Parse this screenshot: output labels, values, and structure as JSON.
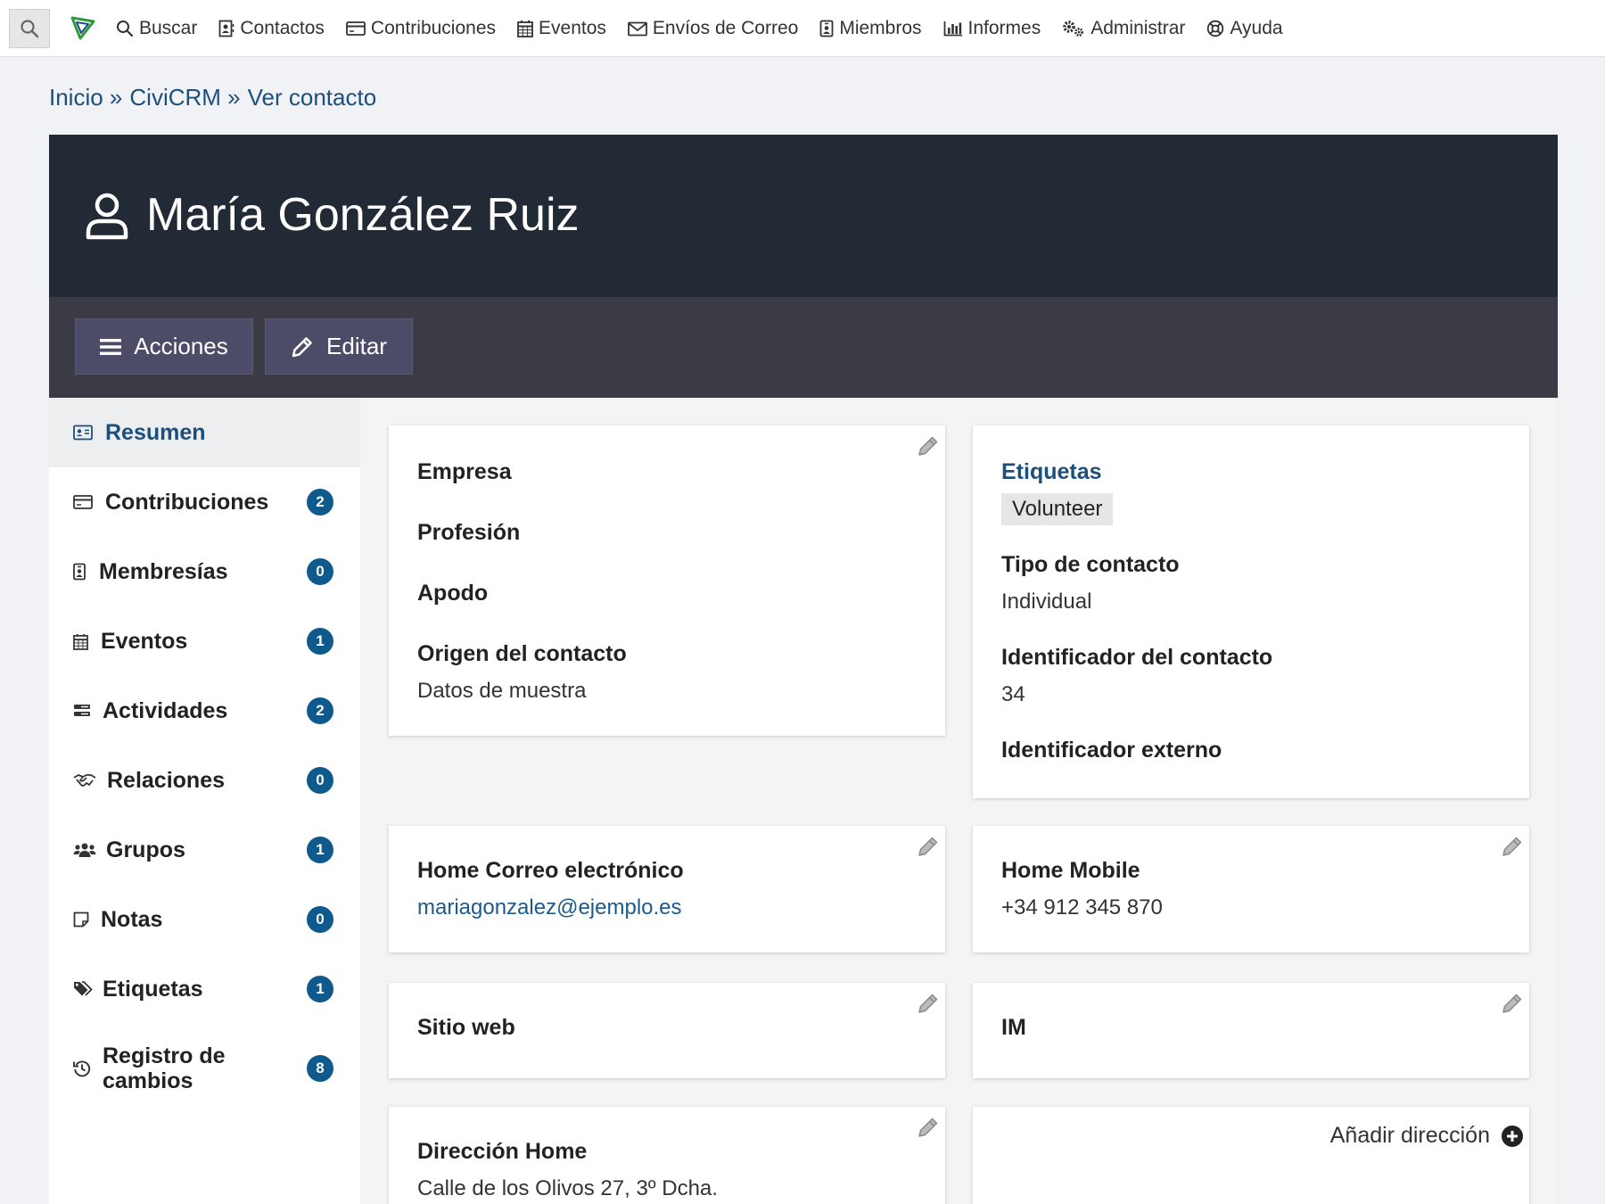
{
  "menu": {
    "items": [
      {
        "label": "Buscar",
        "icon": "search-icon"
      },
      {
        "label": "Contactos",
        "icon": "contacts-icon"
      },
      {
        "label": "Contribuciones",
        "icon": "credit-card-icon"
      },
      {
        "label": "Eventos",
        "icon": "calendar-icon"
      },
      {
        "label": "Envíos de Correo",
        "icon": "envelope-icon"
      },
      {
        "label": "Miembros",
        "icon": "id-badge-icon"
      },
      {
        "label": "Informes",
        "icon": "bar-chart-icon"
      },
      {
        "label": "Administrar",
        "icon": "gears-icon"
      },
      {
        "label": "Ayuda",
        "icon": "life-ring-icon"
      }
    ]
  },
  "breadcrumb": [
    "Inicio »",
    "CiviCRM »",
    "Ver contacto"
  ],
  "contact": {
    "name": "María González Ruiz"
  },
  "actions": {
    "acciones_label": "Acciones",
    "editar_label": "Editar"
  },
  "tabs": [
    {
      "label": "Resumen",
      "count": null,
      "active": true,
      "icon": "id-card-icon"
    },
    {
      "label": "Contribuciones",
      "count": "2",
      "icon": "credit-card-icon"
    },
    {
      "label": "Membresías",
      "count": "0",
      "icon": "id-badge-icon"
    },
    {
      "label": "Eventos",
      "count": "1",
      "icon": "calendar-icon"
    },
    {
      "label": "Actividades",
      "count": "2",
      "icon": "tasks-icon"
    },
    {
      "label": "Relaciones",
      "count": "0",
      "icon": "handshake-icon"
    },
    {
      "label": "Grupos",
      "count": "1",
      "icon": "users-icon"
    },
    {
      "label": "Notas",
      "count": "0",
      "icon": "sticky-note-icon"
    },
    {
      "label": "Etiquetas",
      "count": "1",
      "icon": "tags-icon"
    },
    {
      "label": "Registro de cambios",
      "count": "8",
      "icon": "history-icon"
    }
  ],
  "summary": {
    "empresa_label": "Empresa",
    "profesion_label": "Profesión",
    "apodo_label": "Apodo",
    "origen_label": "Origen del contacto",
    "origen_value": "Datos de muestra",
    "etiquetas_label": "Etiquetas",
    "etiqueta_tag": "Volunteer",
    "tipo_label": "Tipo de contacto",
    "tipo_value": "Individual",
    "id_label": "Identificador del contacto",
    "id_value": "34",
    "ext_id_label": "Identificador externo"
  },
  "email": {
    "label": "Home Correo electrónico",
    "value": "mariagonzalez@ejemplo.es"
  },
  "phone": {
    "label": "Home Mobile",
    "value": "+34 912 345 870"
  },
  "website": {
    "label": "Sitio web"
  },
  "im": {
    "label": "IM"
  },
  "address": {
    "label": "Dirección Home",
    "line1": "Calle de los Olivos 27, 3º Dcha."
  },
  "add_address_label": "Añadir dirección",
  "colors": {
    "header_bg": "#222a36",
    "action_bg": "#3b3b45",
    "badge": "#0f5a8c",
    "link": "#1c4f7c"
  }
}
